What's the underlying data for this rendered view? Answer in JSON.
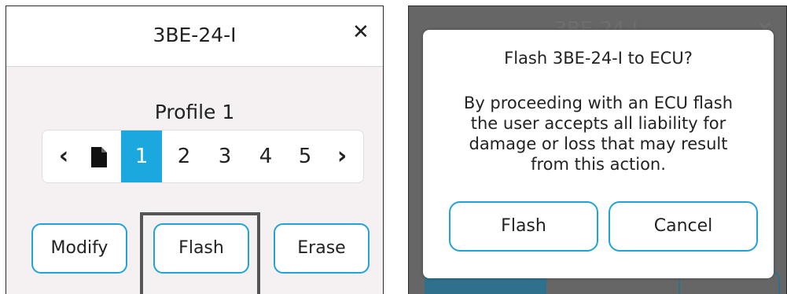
{
  "left_panel": {
    "title": "3BE-24-I",
    "close_glyph": "✕",
    "profile_label": "Profile 1",
    "pager": {
      "prev_glyph": "‹",
      "file_icon": "file-icon",
      "pages": [
        "1",
        "2",
        "3",
        "4",
        "5"
      ],
      "active_page": "1",
      "next_glyph": "›"
    },
    "buttons": {
      "modify": "Modify",
      "flash": "Flash",
      "erase": "Erase"
    }
  },
  "right_panel": {
    "background_title": "3BE-24-I",
    "dialog": {
      "title": "Flash 3BE-24-I to ECU?",
      "body_lines": [
        "By proceeding with an ECU flash",
        "the user accepts all liability for",
        "damage or loss that may result",
        "from this action."
      ],
      "flash_label": "Flash",
      "cancel_label": "Cancel"
    }
  },
  "colors": {
    "accent": "#1ba8df",
    "panel_bg": "#f5f0f2",
    "highlight": "#555555"
  }
}
